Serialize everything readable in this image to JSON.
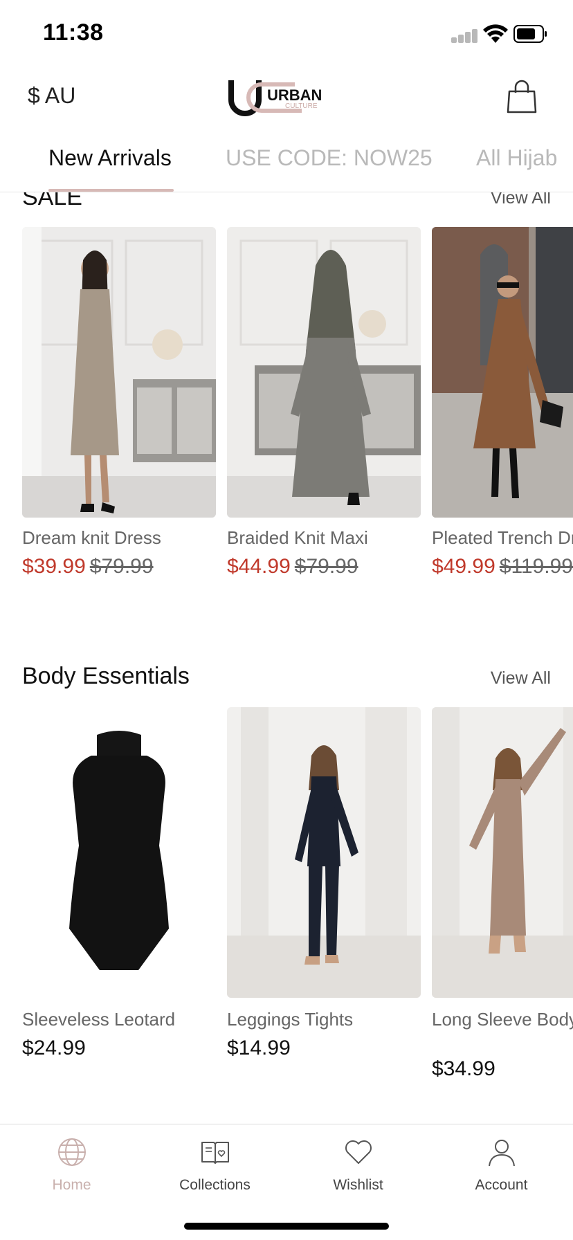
{
  "status_bar": {
    "time": "11:38"
  },
  "header": {
    "currency": "$ AU",
    "logo_text": "URBAN",
    "logo_subtext": "CULTURE",
    "bag_icon": "shopping-bag-icon"
  },
  "tabs": [
    {
      "label": "New Arrivals",
      "active": true
    },
    {
      "label": "USE CODE: NOW25",
      "active": false
    },
    {
      "label": "All Hijab",
      "active": false
    }
  ],
  "sections": [
    {
      "title": "SALE",
      "view_all": "View All",
      "products": [
        {
          "name": "Dream knit Dress",
          "sale_price": "$39.99",
          "original_price": "$79.99"
        },
        {
          "name": "Braided Knit Maxi",
          "sale_price": "$44.99",
          "original_price": "$79.99"
        },
        {
          "name": "Pleated Trench Dress",
          "sale_price": "$49.99",
          "original_price": "$119.99"
        }
      ]
    },
    {
      "title": "Body Essentials",
      "view_all": "View All",
      "products": [
        {
          "name": "Sleeveless Leotard",
          "price": "$24.99"
        },
        {
          "name": "Leggings Tights",
          "price": "$14.99"
        },
        {
          "name": "Long Sleeve Bodycon Dress",
          "price": "$34.99"
        }
      ]
    }
  ],
  "bottom_nav": [
    {
      "label": "Home",
      "icon": "globe-icon",
      "active": true
    },
    {
      "label": "Collections",
      "icon": "book-icon",
      "active": false
    },
    {
      "label": "Wishlist",
      "icon": "heart-icon",
      "active": false
    },
    {
      "label": "Account",
      "icon": "person-icon",
      "active": false
    }
  ],
  "colors": {
    "accent": "#d7b9b6",
    "sale": "#c0392b",
    "inactive_tab": "#b9b9b9"
  }
}
